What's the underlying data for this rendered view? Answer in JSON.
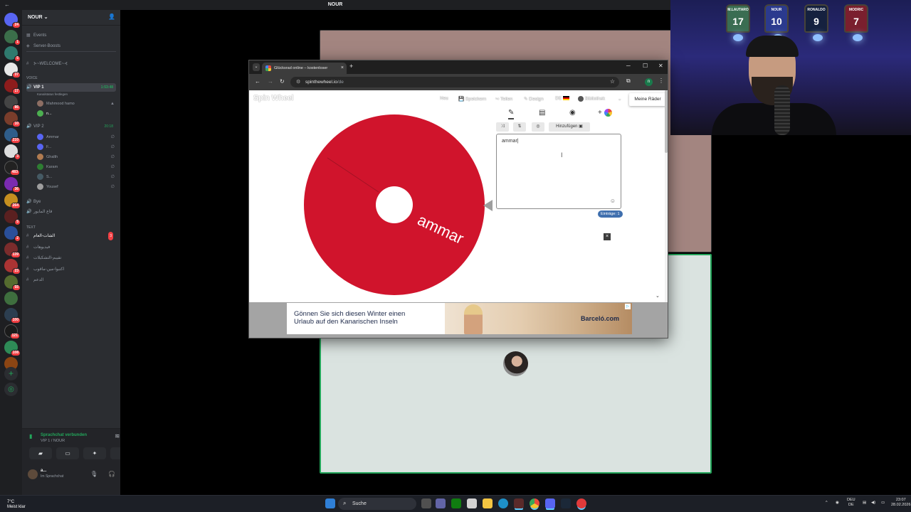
{
  "colors": {
    "wheel": "#d0142c",
    "discord_green": "#23a55a",
    "discord_bg": "#2b2d31",
    "entries_badge": "#3f6fae"
  },
  "discord": {
    "window_title": "NOUR",
    "server_name": "NOUR",
    "menu": [
      {
        "icon": "calendar-icon",
        "label": "Events"
      },
      {
        "icon": "boost-icon",
        "label": "Server-Boosts"
      }
    ],
    "channels": {
      "welcome": "⊱~WELCOME~⊰",
      "voice_category": "VOICE",
      "vip1": "VIP 1",
      "vip1_status": "Kanalstatus festlegen",
      "vip1_timer": "1:53:48",
      "vip1_members": [
        "Mahmood hamo",
        "n..."
      ],
      "vip2": "VIP 2",
      "vip2_timer": "20:18",
      "vip2_members": [
        "Ammar",
        "F...",
        "Ghalth",
        "Karam",
        "S...",
        "Yousef"
      ],
      "afk": "Bye",
      "voice_other": "قاع المايور",
      "text_category": "TEXT",
      "text_channels": [
        "الشات-العام",
        "فيديوهات",
        "تقييم-التشكيلات",
        "اكتبوا-مين-ماقوب",
        "الدعم"
      ],
      "text_badge": "3"
    },
    "voice_panel": {
      "title": "Sprachchat verbunden",
      "subtitle": "VIP 1 / NOUR"
    },
    "user": {
      "name": "a...",
      "status": "Im Sprachchat"
    },
    "server_badges": [
      "24",
      "1",
      "5",
      "37",
      "17",
      "86",
      "10",
      "210",
      "3",
      "483",
      "36",
      "264",
      "5",
      "2",
      "139",
      "23",
      "55",
      "100",
      "121",
      "108"
    ]
  },
  "browser": {
    "tab_title": "Glücksrad online – kostenloser",
    "url_domain": "spinthewheel.io",
    "url_path": "/de",
    "profile_initial": "n",
    "site": {
      "logo": "Spin Wheel",
      "nav": [
        "Neu",
        "Speichern",
        "Teilen",
        "Design",
        "DE",
        "Bibliothek"
      ],
      "my_wheels": "Meine Räder",
      "add_button": "Hinzufügen",
      "entries_text": "ammar",
      "entries_count": "Einträge: 1",
      "wheel_label": "ammar"
    },
    "ad": {
      "line1": "Gönnen Sie sich diesen Winter einen",
      "line2": "Urlaub auf den Kanarischen Inseln",
      "brand": "Barceló.com"
    }
  },
  "taskbar": {
    "weather_temp": "7°C",
    "weather_desc": "Meist klar",
    "search": "Suche",
    "lang": "DEU",
    "lang_sub": "DE",
    "time": "23:07",
    "date": "28.02.2026"
  }
}
